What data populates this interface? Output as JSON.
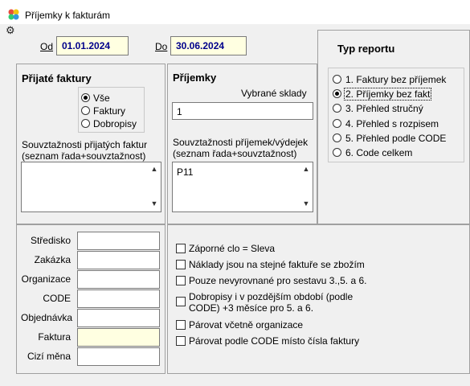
{
  "window": {
    "title": "Příjemky k fakturám"
  },
  "period": {
    "od_label": "Od",
    "od_value": "01.01.2024",
    "do_label": "Do",
    "do_value": "30.06.2024"
  },
  "prijate": {
    "title": "Přijaté faktury",
    "options": [
      "Vše",
      "Faktury",
      "Dobropisy"
    ],
    "selected": 0,
    "souvz_label_1": "Souvztažnosti  přijatých faktur",
    "souvz_label_2": "(seznam řada+souvztažnost)",
    "souvz_value": ""
  },
  "prijemky": {
    "title": "Příjemky",
    "sklady_label": "Vybrané sklady",
    "sklady_value": "1",
    "souvz_label_1": "Souvztažnosti  příjemek/výdejek",
    "souvz_label_2": "(seznam řada+souvztažnost)",
    "souvz_value": "P11"
  },
  "typ": {
    "title": "Typ reportu",
    "options": [
      "1. Faktury bez příjemek",
      "2. Příjemky bez fakt",
      "3. Přehled stručný",
      "4. Přehled s rozpisem",
      "5. Přehled podle CODE",
      "6. Code celkem"
    ],
    "selected": 1
  },
  "filters": [
    {
      "label": "Středisko",
      "value": ""
    },
    {
      "label": "Zakázka",
      "value": ""
    },
    {
      "label": "Organizace",
      "value": ""
    },
    {
      "label": "CODE",
      "value": ""
    },
    {
      "label": "Objednávka",
      "value": ""
    },
    {
      "label": "Faktura",
      "value": ""
    },
    {
      "label": "Cizí měna",
      "value": ""
    }
  ],
  "checks": [
    {
      "label": "Záporné clo = Sleva",
      "checked": false
    },
    {
      "label": "Náklady jsou na stejné faktuře se zbožím",
      "checked": false
    },
    {
      "label": "Pouze nevyrovnané pro sestavu 3.,5. a 6.",
      "checked": false
    },
    {
      "label_1": "Dobropisy i v pozdějším období (podle",
      "label_2": "CODE) +3 měsíce pro 5. a 6.",
      "checked": false
    },
    {
      "label": "Párovat včetně organizace",
      "checked": false
    },
    {
      "label": "Párovat podle CODE místo čísla faktury",
      "checked": false
    }
  ]
}
